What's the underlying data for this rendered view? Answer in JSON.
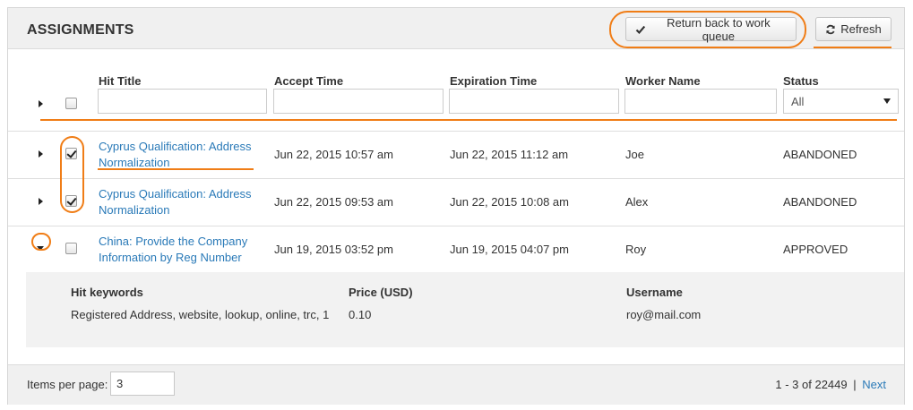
{
  "panel": {
    "title": "ASSIGNMENTS",
    "return_label": "Return back to work queue",
    "refresh_label": "Refresh"
  },
  "columns": {
    "hit_title": "Hit Title",
    "accept_time": "Accept Time",
    "expiration_time": "Expiration Time",
    "worker_name": "Worker Name",
    "status": "Status"
  },
  "filters": {
    "status_selected": "All"
  },
  "rows": [
    {
      "title_line1": "Cyprus Qualification: Address",
      "title_line2": "Normalization",
      "accept_time": "Jun 22, 2015 10:57 am",
      "expiration_time": "Jun 22, 2015 11:12 am",
      "worker": "Joe",
      "status": "ABANDONED",
      "checked": true,
      "expanded": false
    },
    {
      "title_line1": "Cyprus Qualification: Address",
      "title_line2": "Normalization",
      "accept_time": "Jun 22, 2015 09:53 am",
      "expiration_time": "Jun 22, 2015 10:08 am",
      "worker": "Alex",
      "status": "ABANDONED",
      "checked": true,
      "expanded": false
    },
    {
      "title_line1": "China: Provide the Company",
      "title_line2": "Information by Reg Number",
      "accept_time": "Jun 19, 2015 03:52 pm",
      "expiration_time": "Jun 19, 2015 04:07 pm",
      "worker": "Roy",
      "status": "APPROVED",
      "checked": false,
      "expanded": true
    }
  ],
  "detail": {
    "keywords_label": "Hit keywords",
    "keywords_value": "Registered Address, website, lookup, online, trc, 1",
    "price_label": "Price (USD)",
    "price_value": "0.10",
    "username_label": "Username",
    "username_value": "roy@mail.com"
  },
  "footer": {
    "items_per_page_label": "Items per page:",
    "items_per_page_value": "3",
    "range_text": "1 - 3 of 22449",
    "separator": "|",
    "next_label": "Next"
  },
  "icons": {
    "return": "checkmark-icon",
    "refresh": "refresh-icon",
    "dropdown": "dropdown-arrow-icon",
    "expand": "caret-right-icon",
    "collapse": "caret-down-icon"
  },
  "colors": {
    "link": "#2a7ab8",
    "annotation": "#f07d16",
    "header_bg": "#f0f0f0",
    "detail_bg": "#f2f2f2"
  }
}
